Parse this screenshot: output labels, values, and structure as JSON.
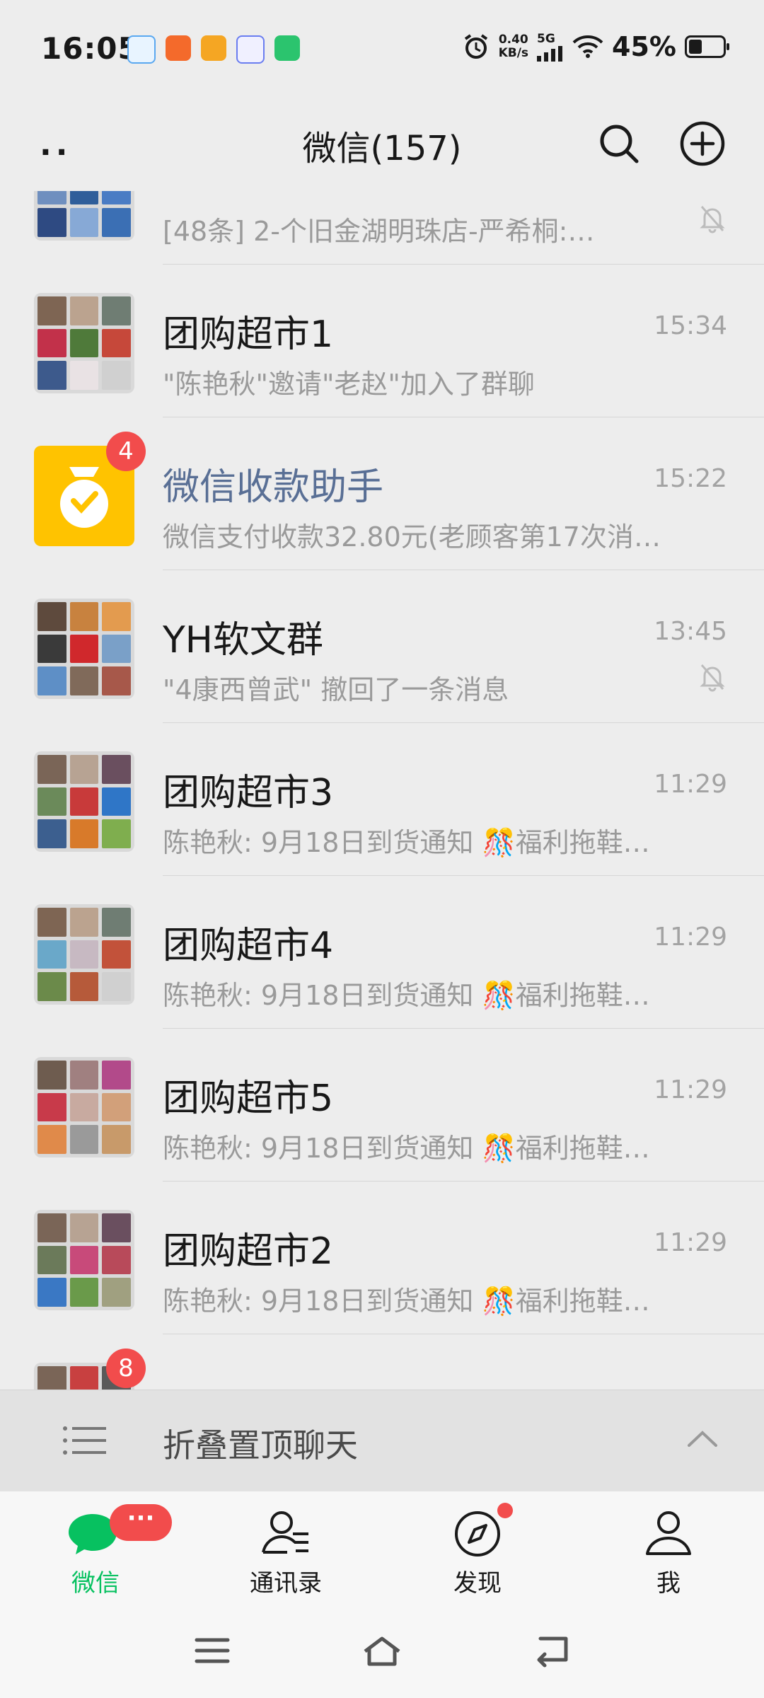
{
  "status_bar": {
    "time": "16:05",
    "net_speed_value": "0.40",
    "net_speed_unit": "KB/s",
    "network": "5G",
    "battery": "45%"
  },
  "header": {
    "title": "微信(157)"
  },
  "chats": [
    {
      "name": "...",
      "preview": "[48条] 2-个旧金湖明珠店-严希桐:…",
      "time": "",
      "muted": true,
      "badge": ""
    },
    {
      "name": "团购超市1",
      "preview": "\"陈艳秋\"邀请\"老赵\"加入了群聊",
      "time": "15:34",
      "muted": false,
      "badge": ""
    },
    {
      "name": "微信收款助手",
      "preview": "微信支付收款32.80元(老顾客第17次消…",
      "time": "15:22",
      "muted": false,
      "badge": "4"
    },
    {
      "name": "YH软文群",
      "preview": "\"4康西曾武\" 撤回了一条消息",
      "time": "13:45",
      "muted": true,
      "badge": ""
    },
    {
      "name": "团购超市3",
      "preview": "陈艳秋: 9月18日到货通知 🎊福利拖鞋…",
      "time": "11:29",
      "muted": false,
      "badge": ""
    },
    {
      "name": "团购超市4",
      "preview": "陈艳秋: 9月18日到货通知 🎊福利拖鞋…",
      "time": "11:29",
      "muted": false,
      "badge": ""
    },
    {
      "name": "团购超市5",
      "preview": "陈艳秋: 9月18日到货通知 🎊福利拖鞋…",
      "time": "11:29",
      "muted": false,
      "badge": ""
    },
    {
      "name": "团购超市2",
      "preview": "陈艳秋: 9月18日到货通知 🎊福利拖鞋…",
      "time": "11:29",
      "muted": false,
      "badge": ""
    },
    {
      "name": "",
      "preview": "",
      "time": "",
      "muted": false,
      "badge": "8"
    }
  ],
  "fold_bar": {
    "label": "折叠置顶聊天"
  },
  "tabs": [
    {
      "label": "微信",
      "badge": "···",
      "active": true
    },
    {
      "label": "通讯录",
      "active": false
    },
    {
      "label": "发现",
      "active": false
    },
    {
      "label": "我",
      "active": false
    }
  ],
  "colors": {
    "accent": "#07c160",
    "badge": "#f24c4c",
    "link_name": "#596f95",
    "payment_icon_bg": "#ffc300"
  }
}
